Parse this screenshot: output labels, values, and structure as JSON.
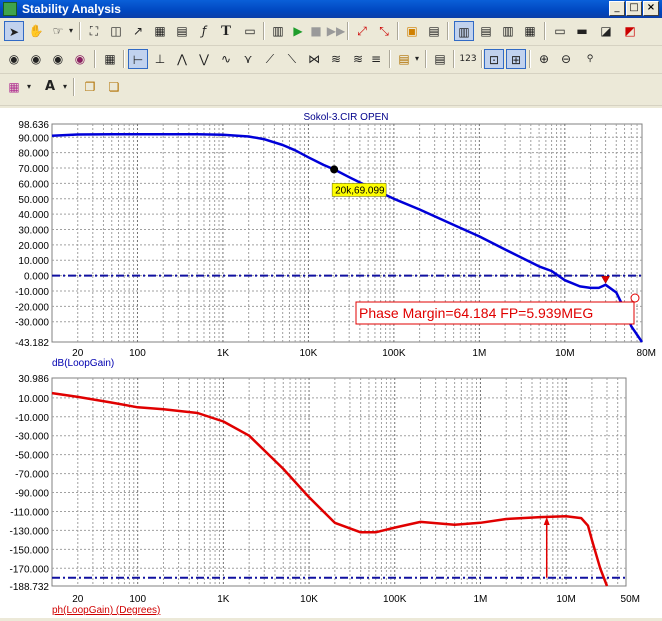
{
  "window": {
    "title": "Stability Analysis",
    "minimize": "_",
    "maximize": "□",
    "close": "×"
  },
  "toolbars": {
    "row1": [
      "pointer-icon",
      "pan-icon",
      "cursor-icon",
      "zoom-area-icon",
      "annotate-icon",
      "label-icon",
      "formula-icon",
      "text-icon",
      "open-icon",
      "run-icon",
      "stop-icon",
      "step-icon",
      "cursor-left-icon",
      "cursor-right-icon",
      "frame-icon",
      "grid-icon",
      "layout1-icon",
      "layout2-icon",
      "layout3-icon",
      "layout4-icon",
      "layout5-icon",
      "layout6-icon",
      "layout7-icon",
      "layout8-icon"
    ],
    "row2": [
      "peak-icon",
      "valley-icon",
      "high-icon",
      "low-icon",
      "table-icon",
      "slope-icon",
      "min-icon",
      "max-icon",
      "inflection-icon",
      "wave-icon",
      "curve-icon",
      "rise-icon",
      "fall-icon",
      "cross-icon",
      "level-icon",
      "clipboard-icon",
      "list-icon",
      "value-icon",
      "fit-icon",
      "fit2-icon",
      "zoom-in-icon",
      "zoom-out-icon",
      "zoom-reset-icon"
    ],
    "row3": [
      "color-palette-icon",
      "font-icon",
      "copy-icon",
      "paste-icon"
    ]
  },
  "plot": {
    "header": "Sokol-3.CIR OPEN"
  },
  "chart_data": [
    {
      "type": "line",
      "title": "Sokol-3.CIR OPEN",
      "xlabel": "",
      "ylabel": "dB(LoopGain)",
      "xscale": "log",
      "xlim": [
        10,
        80000000
      ],
      "ylim": [
        -43.182,
        98.636
      ],
      "x_ticks": [
        {
          "v": 20,
          "label": "20"
        },
        {
          "v": 100,
          "label": "100"
        },
        {
          "v": 1000,
          "label": "1K"
        },
        {
          "v": 10000,
          "label": "10K"
        },
        {
          "v": 100000,
          "label": "100K"
        },
        {
          "v": 1000000,
          "label": "1M"
        },
        {
          "v": 10000000,
          "label": "10M"
        },
        {
          "v": 80000000,
          "label": "80M"
        }
      ],
      "y_ticks": [
        "98.636",
        "90.000",
        "80.000",
        "70.000",
        "60.000",
        "50.000",
        "40.000",
        "30.000",
        "20.000",
        "10.000",
        "0.000",
        "-10.000",
        "-20.000",
        "-30.000",
        "-43.182"
      ],
      "y_tick_values": [
        98.636,
        90,
        80,
        70,
        60,
        50,
        40,
        30,
        20,
        10,
        0,
        -10,
        -20,
        -30,
        -43.182
      ],
      "series": [
        {
          "name": "dB(LoopGain)",
          "color": "#0000d8",
          "x": [
            10,
            20,
            50,
            100,
            200,
            500,
            1000,
            2000,
            3000,
            5000,
            7000,
            10000,
            15000,
            20000,
            30000,
            50000,
            70000,
            100000,
            200000,
            500000,
            1000000,
            2000000,
            5000000,
            7000000,
            10000000,
            15000000,
            20000000,
            25000000,
            30000000,
            40000000,
            50000000,
            60000000,
            80000000
          ],
          "y": [
            91,
            91.8,
            92,
            92,
            92,
            92,
            91.7,
            90.5,
            88.8,
            85,
            81.5,
            77,
            72,
            69.1,
            64,
            58,
            54,
            50,
            43,
            33,
            25.5,
            17,
            6,
            3,
            -3,
            -7,
            -8,
            -8,
            -6,
            -11,
            -22,
            -33,
            -43.182
          ]
        }
      ],
      "reference_line": {
        "y": 0,
        "style": "dash-dot"
      },
      "marker": {
        "x": 20000,
        "y": 69.099,
        "label": "20k,69.099"
      },
      "peak_marker": {
        "x": 30000000,
        "y": -5
      }
    },
    {
      "type": "line",
      "xlabel": "",
      "ylabel": "ph(LoopGain) (Degrees)",
      "xscale": "log",
      "xlim": [
        10,
        50000000
      ],
      "ylim": [
        -188.732,
        30.986
      ],
      "x_ticks": [
        {
          "v": 20,
          "label": "20"
        },
        {
          "v": 100,
          "label": "100"
        },
        {
          "v": 1000,
          "label": "1K"
        },
        {
          "v": 10000,
          "label": "10K"
        },
        {
          "v": 100000,
          "label": "100K"
        },
        {
          "v": 1000000,
          "label": "1M"
        },
        {
          "v": 10000000,
          "label": "10M"
        },
        {
          "v": 50000000,
          "label": "50M"
        }
      ],
      "y_ticks": [
        "30.986",
        "10.000",
        "-10.000",
        "-30.000",
        "-50.000",
        "-70.000",
        "-90.000",
        "-110.000",
        "-130.000",
        "-150.000",
        "-170.000",
        "-188.732"
      ],
      "y_tick_values": [
        30.986,
        10,
        -10,
        -30,
        -50,
        -70,
        -90,
        -110,
        -130,
        -150,
        -170,
        -188.732
      ],
      "series": [
        {
          "name": "ph(LoopGain) (Degrees)",
          "color": "#e00000",
          "x": [
            10,
            20,
            50,
            100,
            200,
            500,
            1000,
            2000,
            5000,
            10000,
            20000,
            40000,
            60000,
            100000,
            200000,
            500000,
            1000000,
            2000000,
            5000000,
            10000000,
            15000000,
            18000000,
            20000000,
            25000000,
            30000000
          ],
          "y": [
            15,
            11,
            5,
            0,
            -2,
            -6,
            -15,
            -30,
            -65,
            -95,
            -122,
            -132,
            -132,
            -127,
            -121,
            -124,
            -122,
            -118,
            -116,
            -115,
            -117,
            -125,
            -140,
            -170,
            -188.732
          ]
        }
      ],
      "reference_line": {
        "y": -180,
        "style": "dash-dot"
      },
      "annotation": {
        "label": "Phase Margin=64.184 FP=5.939MEG",
        "x": 5939000,
        "y": -115.816
      },
      "arrow": {
        "x": 5939000,
        "from_y": -180,
        "to_y": -115.816
      }
    }
  ]
}
